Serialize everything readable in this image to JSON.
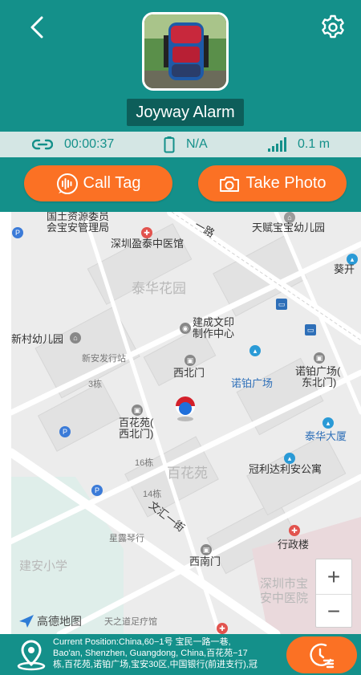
{
  "header": {
    "device_name": "Joyway Alarm",
    "icons": {
      "back": "chevron-left-icon",
      "settings": "gear-icon"
    }
  },
  "status": {
    "duration": "00:00:37",
    "battery": "N/A",
    "distance": "0.1 m"
  },
  "actions": {
    "call_label": "Call Tag",
    "photo_label": "Take Photo"
  },
  "map": {
    "labels": {
      "l1": "国土资源委员",
      "l2": "会宝安管理局",
      "l3": "深圳盈泰中医馆",
      "l4": "天赋宝宝幼儿园",
      "l5": "葵开",
      "l6": "泰华花园",
      "l7": "建成文印",
      "l8": "制作中心",
      "l9": "新村幼儿园",
      "l10": "新安发行站",
      "l11": "西北门",
      "l12": "诺铂广场",
      "l13": "诺铂广场(",
      "l14": "东北门)",
      "l15": "3栋",
      "l16": "百花苑(",
      "l17": "西北门)",
      "l18": "泰华大厦",
      "l19": "16栋",
      "l20": "百花苑",
      "l21": "冠利达利安公寓",
      "l22": "14栋",
      "l23": "文汇一街",
      "l24": "星露琴行",
      "l25": "行政楼",
      "l26": "建安小学",
      "l27": "西南门",
      "l28": "深圳市宝",
      "l29": "安中医院",
      "l30": "天之道足疗馆",
      "l31": "一路"
    },
    "logo": "高德地图",
    "zoom_in": "+",
    "zoom_out": "−"
  },
  "footer": {
    "address_line1": "Current Position:China,60−1号 宝民一路一巷,",
    "address_line2": "Bao'an, Shenzhen, Guangdong, China,百花苑−17",
    "address_line3": "栋,百花苑,诺铂广场,宝安30区,中国银行(前进支行),冠"
  },
  "colors": {
    "teal": "#14908a",
    "dark_teal": "#0d5e5a",
    "orange": "#fb7124",
    "status_bg": "#d4e6e4"
  }
}
